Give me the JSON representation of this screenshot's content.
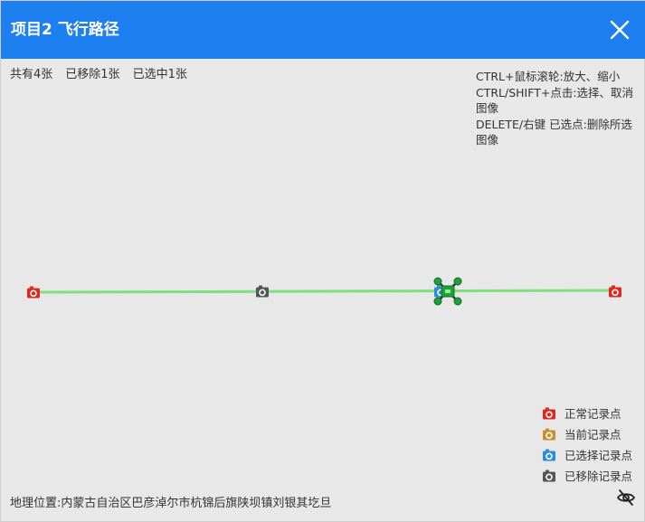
{
  "dialog": {
    "title": "项目2 飞行路径"
  },
  "stats": {
    "total": "共有4张",
    "removed": "已移除1张",
    "selected": "已选中1张"
  },
  "help": {
    "line1": "CTRL+鼠标滚轮:放大、缩小",
    "line2": "CTRL/SHIFT+点击:选择、取消图像",
    "line3": "DELETE/右键 已选点:删除所选图像"
  },
  "legend": {
    "items": [
      {
        "label": "正常记录点",
        "color": "#e0281e",
        "icon": "camera-icon"
      },
      {
        "label": "当前记录点",
        "color": "#c8902e",
        "icon": "camera-icon"
      },
      {
        "label": "已选择记录点",
        "color": "#2b8fd8",
        "icon": "camera-icon"
      },
      {
        "label": "已移除记录点",
        "color": "#555555",
        "icon": "camera-icon"
      }
    ]
  },
  "location": {
    "text": "地理位置:内蒙古自治区巴彦淖尔市杭锦后旗陕坝镇刘银其圪旦"
  },
  "colors": {
    "titlebar": "#1e7ff0",
    "path_line": "#7ee07e",
    "drone": "#1fa03a"
  }
}
